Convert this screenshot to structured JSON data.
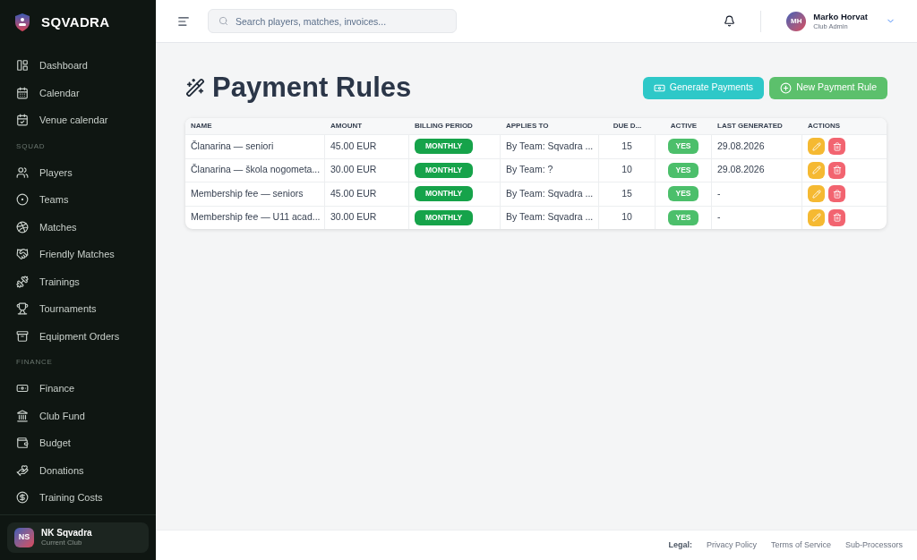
{
  "brand": "SQVADRA",
  "sidebar": {
    "sections": [
      {
        "items": [
          {
            "label": "Dashboard",
            "selected": false
          },
          {
            "label": "Calendar",
            "selected": false
          },
          {
            "label": "Venue calendar",
            "selected": false
          }
        ]
      },
      {
        "title": "SQUAD",
        "items": [
          {
            "label": "Players",
            "selected": false
          },
          {
            "label": "Teams",
            "selected": false
          },
          {
            "label": "Matches",
            "selected": false
          },
          {
            "label": "Friendly Matches",
            "selected": false
          },
          {
            "label": "Trainings",
            "selected": false
          },
          {
            "label": "Tournaments",
            "selected": false
          },
          {
            "label": "Equipment Orders",
            "selected": false
          }
        ]
      },
      {
        "title": "FINANCE",
        "items": [
          {
            "label": "Finance",
            "selected": false
          },
          {
            "label": "Club Fund",
            "selected": false
          },
          {
            "label": "Budget",
            "selected": false
          },
          {
            "label": "Donations",
            "selected": false
          },
          {
            "label": "Training Costs",
            "selected": false
          }
        ]
      }
    ],
    "club": {
      "initials": "NS",
      "name": "NK Sqvadra",
      "subtitle": "Current Club"
    }
  },
  "search": {
    "placeholder": "Search players, matches, invoices..."
  },
  "user": {
    "initials": "MH",
    "name": "Marko Horvat",
    "role": "Club Admin"
  },
  "page": {
    "title": "Payment Rules",
    "buttons": [
      "Generate Payments",
      "New Payment Rule"
    ]
  },
  "table": {
    "columns": [
      "NAME",
      "AMOUNT",
      "BILLING PERIOD",
      "APPLIES TO",
      "DUE D...",
      "ACTIVE",
      "LAST GENERATED",
      "ACTIONS"
    ],
    "rows": [
      {
        "name": "Članarina — seniori",
        "amount": "45.00 EUR",
        "period": "MONTHLY",
        "applies_to": "By Team: Sqvadra ...",
        "due": "15",
        "active": true,
        "active_label": "YES",
        "last_generated": "29.08.2026"
      },
      {
        "name": "Članarina — škola nogometa...",
        "amount": "30.00 EUR",
        "period": "MONTHLY",
        "applies_to": "By Team: ?",
        "due": "10",
        "active": true,
        "active_label": "YES",
        "last_generated": "29.08.2026"
      },
      {
        "name": "Membership fee — seniors",
        "amount": "45.00 EUR",
        "period": "MONTHLY",
        "applies_to": "By Team: Sqvadra ...",
        "due": "15",
        "active": true,
        "active_label": "YES",
        "last_generated": "-"
      },
      {
        "name": "Membership fee — U11 acad...",
        "amount": "30.00 EUR",
        "period": "MONTHLY",
        "applies_to": "By Team: Sqvadra ...",
        "due": "10",
        "active": true,
        "active_label": "YES",
        "last_generated": "-"
      }
    ]
  },
  "footer": {
    "label": "Legal:",
    "links": [
      "Privacy Policy",
      "Terms of Service",
      "Sub-Processors"
    ]
  }
}
